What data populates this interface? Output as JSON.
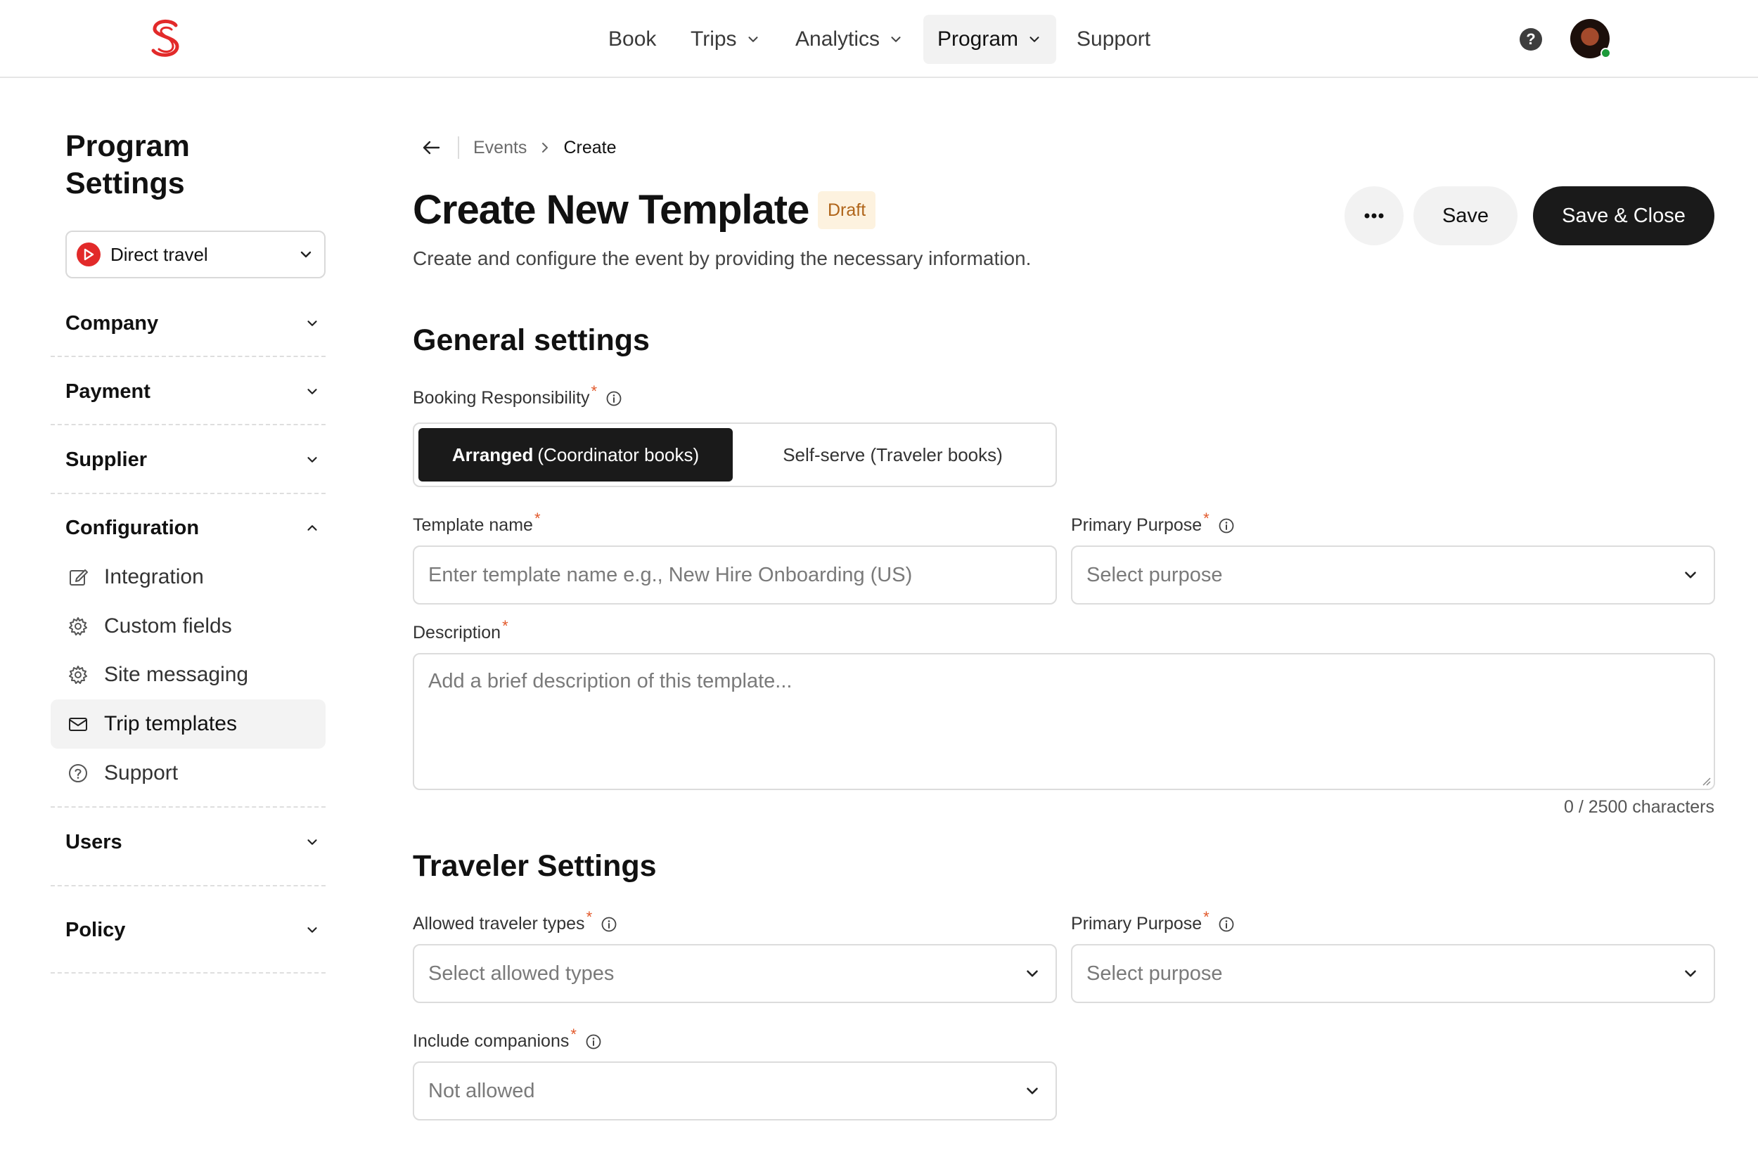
{
  "nav": {
    "items": [
      "Book",
      "Trips",
      "Analytics",
      "Program",
      "Support"
    ],
    "active": "Program"
  },
  "sidebar": {
    "title": "Program Settings",
    "company": "Direct travel",
    "sections": {
      "company": "Company",
      "payment": "Payment",
      "supplier": "Supplier",
      "configuration": "Configuration",
      "users": "Users",
      "policy": "Policy"
    },
    "configuration_items": [
      "Integration",
      "Custom fields",
      "Site messaging",
      "Trip templates",
      "Support"
    ],
    "active_item": "Trip templates"
  },
  "breadcrumb": {
    "parent": "Events",
    "current": "Create"
  },
  "header": {
    "title": "Create New Template",
    "badge": "Draft",
    "subtitle": "Create and configure the event by providing the necessary information.",
    "save_label": "Save",
    "save_close_label": "Save & Close"
  },
  "general": {
    "heading": "General settings",
    "booking_label": "Booking Responsibility",
    "booking_on_bold": "Arranged",
    "booking_on_rest": "(Coordinator books)",
    "booking_off": "Self-serve (Traveler books)",
    "template_name_label": "Template name",
    "template_name_placeholder": "Enter template name e.g., New Hire Onboarding (US)",
    "purpose_label": "Primary Purpose",
    "purpose_placeholder": "Select purpose",
    "description_label": "Description",
    "description_placeholder": "Add a brief description of this template...",
    "counter": "0 / 2500 characters"
  },
  "traveler": {
    "heading": "Traveler Settings",
    "types_label": "Allowed traveler types",
    "types_placeholder": "Select allowed types",
    "purpose_label": "Primary Purpose",
    "purpose_placeholder": "Select purpose",
    "companions_label": "Include companions",
    "companions_value": "Not allowed"
  },
  "colors": {
    "brand": "#e22a2a",
    "primary_button": "#1a1a1a",
    "draft_bg": "#fdf2df",
    "draft_text": "#b0651a",
    "required": "#e2582a",
    "online": "#1d9a3a"
  }
}
